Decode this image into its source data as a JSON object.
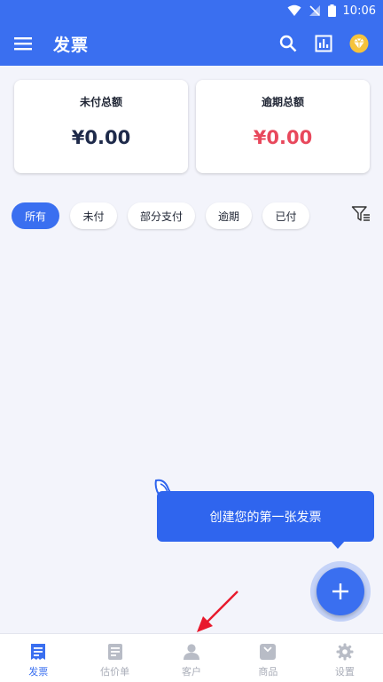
{
  "status_bar": {
    "time": "10:06"
  },
  "app_bar": {
    "title": "发票"
  },
  "summary": {
    "unpaid": {
      "label": "未付总额",
      "amount": "¥0.00",
      "color": "#1e2a4a"
    },
    "overdue": {
      "label": "逾期总额",
      "amount": "¥0.00",
      "color": "#e8485c"
    }
  },
  "filters": [
    {
      "label": "所有",
      "active": true
    },
    {
      "label": "未付",
      "active": false
    },
    {
      "label": "部分支付",
      "active": false
    },
    {
      "label": "逾期",
      "active": false
    },
    {
      "label": "已付",
      "active": false
    }
  ],
  "tooltip": {
    "text": "创建您的第一张发票"
  },
  "bottom_nav": [
    {
      "label": "发票",
      "icon": "invoice-icon",
      "active": true
    },
    {
      "label": "估价单",
      "icon": "estimate-icon",
      "active": false
    },
    {
      "label": "客户",
      "icon": "person-icon",
      "active": false
    },
    {
      "label": "商品",
      "icon": "box-icon",
      "active": false
    },
    {
      "label": "设置",
      "icon": "gear-icon",
      "active": false
    }
  ],
  "colors": {
    "primary": "#3a6ff0",
    "background": "#f3f4fb",
    "arrow": "#e8192c"
  }
}
